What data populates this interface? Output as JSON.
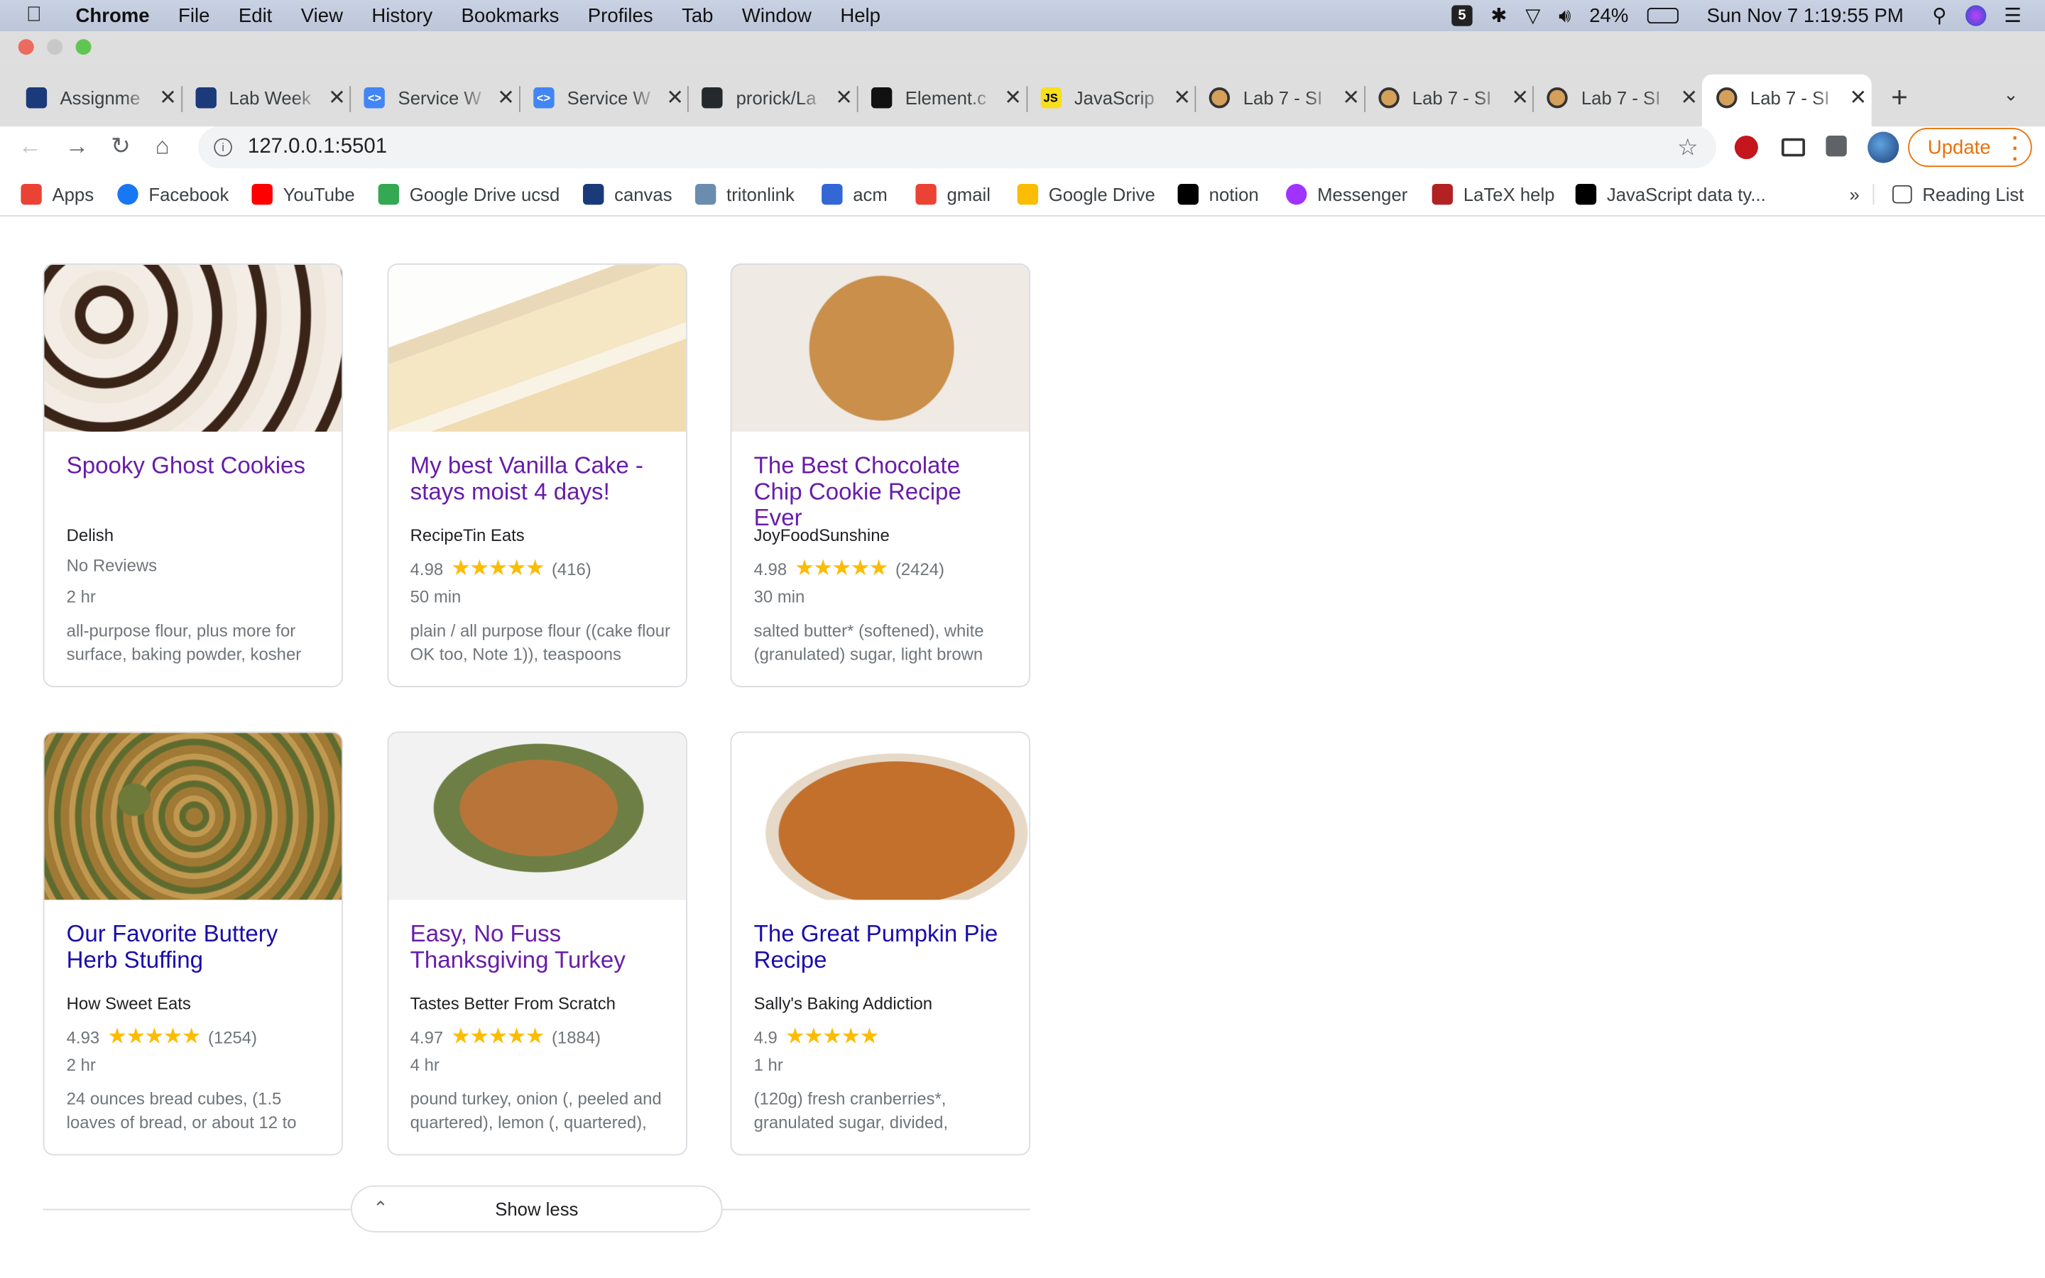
{
  "menubar": {
    "app": "Chrome",
    "items": [
      "File",
      "Edit",
      "View",
      "History",
      "Bookmarks",
      "Profiles",
      "Tab",
      "Window",
      "Help"
    ],
    "battery": "24%",
    "clock": "Sun Nov 7  1:19:55 PM"
  },
  "tabs": [
    {
      "title": "Assignme",
      "color": "#1a3a7a",
      "glyph": ""
    },
    {
      "title": "Lab Week",
      "color": "#1a3a7a",
      "glyph": ""
    },
    {
      "title": "Service W",
      "color": "#4285f4",
      "glyph": "<>"
    },
    {
      "title": "Service W",
      "color": "#4285f4",
      "glyph": "<>"
    },
    {
      "title": "prorick/La",
      "color": "#24292e",
      "glyph": ""
    },
    {
      "title": "Element.c",
      "color": "#111111",
      "glyph": ""
    },
    {
      "title": "JavaScrip",
      "color": "#f7df1e",
      "glyph": "JS"
    },
    {
      "title": "Lab 7 - SI",
      "color": "#d4a05a",
      "glyph": ""
    },
    {
      "title": "Lab 7 - SI",
      "color": "#d4a05a",
      "glyph": ""
    },
    {
      "title": "Lab 7 - SI",
      "color": "#d4a05a",
      "glyph": ""
    },
    {
      "title": "Lab 7 - SI",
      "color": "#d4a05a",
      "glyph": ""
    }
  ],
  "address": "127.0.0.1:5501",
  "update_label": "Update",
  "bookmarks": [
    {
      "label": "Apps",
      "color": "#ea4335"
    },
    {
      "label": "Facebook",
      "color": "#1877f2"
    },
    {
      "label": "YouTube",
      "color": "#ff0000"
    },
    {
      "label": "Google Drive ucsd",
      "color": "#34a853"
    },
    {
      "label": "canvas",
      "color": "#1a3a7a"
    },
    {
      "label": "tritonlink",
      "color": "#6a8caf"
    },
    {
      "label": "acm",
      "color": "#3367d6"
    },
    {
      "label": "gmail",
      "color": "#ea4335"
    },
    {
      "label": "Google Drive",
      "color": "#fbbc04"
    },
    {
      "label": "notion",
      "color": "#000000"
    },
    {
      "label": "Messenger",
      "color": "#a033ff"
    },
    {
      "label": "LaTeX help",
      "color": "#b22222"
    },
    {
      "label": "JavaScript data ty...",
      "color": "#000000"
    }
  ],
  "reading_list": "Reading List",
  "recipes": [
    {
      "title": "Spooky Ghost Cookies",
      "org": "Delish",
      "rating": "",
      "stars": "",
      "count": "",
      "no_reviews": "No Reviews",
      "time": "2 hr",
      "ingredients": "all-purpose flour, plus more for surface, baking powder, kosher",
      "visited": true
    },
    {
      "title": "My best Vanilla Cake - stays moist 4 days!",
      "org": "RecipeTin Eats",
      "rating": "4.98",
      "stars": "★★★★★",
      "count": "(416)",
      "no_reviews": "",
      "time": "50 min",
      "ingredients": "plain / all purpose flour ((cake flour OK too, Note 1)), teaspoons",
      "visited": true
    },
    {
      "title": "The Best Chocolate Chip Cookie Recipe Ever",
      "org": "JoyFoodSunshine",
      "rating": "4.98",
      "stars": "★★★★★",
      "count": "(2424)",
      "no_reviews": "",
      "time": "30 min",
      "ingredients": "salted butter* (softened), white (granulated) sugar, light brown",
      "visited": true
    },
    {
      "title": "Our Favorite Buttery Herb Stuffing",
      "org": "How Sweet Eats",
      "rating": "4.93",
      "stars": "★★★★★",
      "count": "(1254)",
      "no_reviews": "",
      "time": "2 hr",
      "ingredients": "24 ounces bread cubes, (1.5 loaves of bread, or about 12 to",
      "visited": false
    },
    {
      "title": "Easy, No Fuss Thanksgiving Turkey",
      "org": "Tastes Better From Scratch",
      "rating": "4.97",
      "stars": "★★★★★",
      "count": "(1884)",
      "no_reviews": "",
      "time": "4 hr",
      "ingredients": "pound turkey, onion (, peeled and quartered), lemon (, quartered),",
      "visited": true
    },
    {
      "title": "The Great Pumpkin Pie Recipe",
      "org": "Sally's Baking Addiction",
      "rating": "4.9",
      "stars": "★★★★★",
      "count": "",
      "no_reviews": "",
      "time": "1 hr",
      "ingredients": "(120g) fresh cranberries*, granulated sugar, divided,",
      "visited": false
    }
  ],
  "show_less": "Show less"
}
